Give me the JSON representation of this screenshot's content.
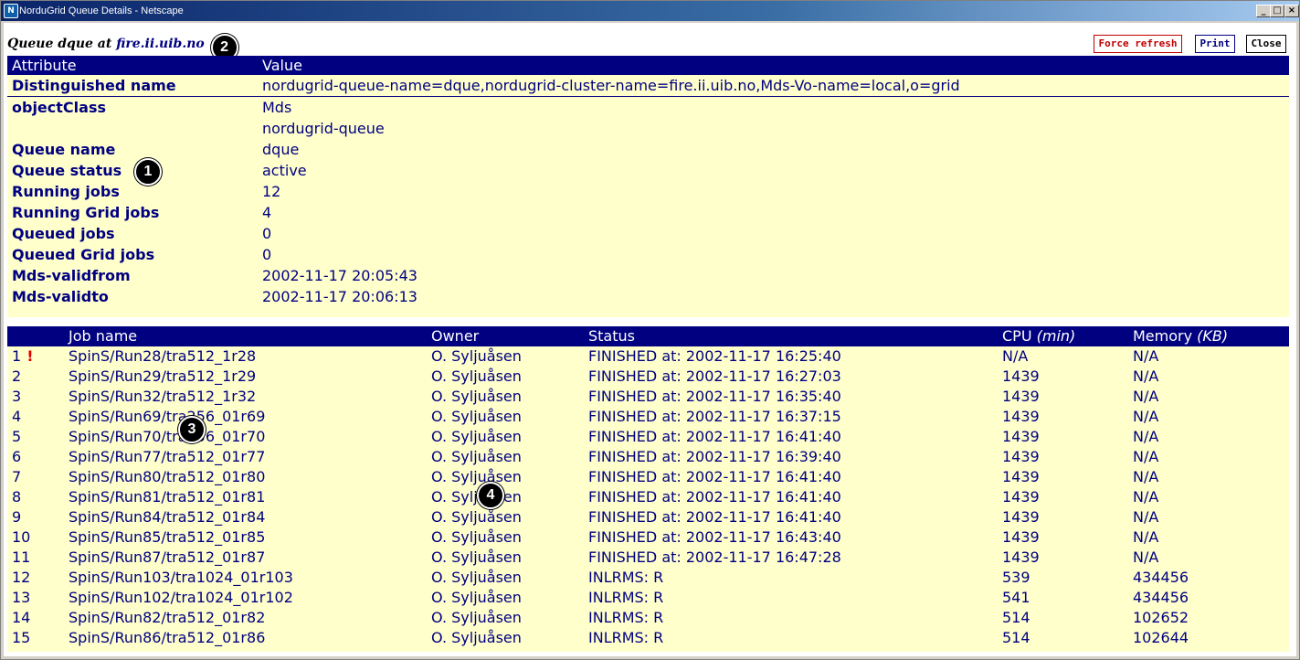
{
  "window": {
    "title": "NorduGrid Queue Details - Netscape",
    "controls": [
      "_",
      "□",
      "×"
    ]
  },
  "heading": {
    "prefix": "Queue dque at",
    "host": "fire.ii.uib.no"
  },
  "buttons": {
    "force_refresh": "Force refresh",
    "print": "Print",
    "close": "Close"
  },
  "colors": {
    "header_bg": "#000080",
    "row_bg": "#ffffcc",
    "text": "#000080",
    "alert": "#e00000"
  },
  "markers": [
    "1",
    "2",
    "3",
    "4"
  ],
  "attributes": {
    "header": {
      "attr": "Attribute",
      "value": "Value"
    },
    "rows": [
      {
        "attr": "Distinguished name",
        "value": "nordugrid-queue-name=dque,nordugrid-cluster-name=fire.ii.uib.no,Mds-Vo-name=local,o=grid"
      },
      {
        "attr": "objectClass",
        "value": "Mds"
      },
      {
        "attr": "",
        "value": "nordugrid-queue"
      },
      {
        "attr": "Queue name",
        "value": "dque"
      },
      {
        "attr": "Queue status",
        "value": "active"
      },
      {
        "attr": "Running jobs",
        "value": "12"
      },
      {
        "attr": "Running Grid jobs",
        "value": "4"
      },
      {
        "attr": "Queued jobs",
        "value": "0"
      },
      {
        "attr": "Queued Grid jobs",
        "value": "0"
      },
      {
        "attr": "Mds-validfrom",
        "value": "2002-11-17 20:05:43"
      },
      {
        "attr": "Mds-validto",
        "value": "2002-11-17 20:06:13"
      }
    ]
  },
  "jobs": {
    "header": {
      "num": "",
      "name": "Job name",
      "owner": "Owner",
      "status": "Status",
      "cpu": "CPU",
      "cpu_unit": "(min)",
      "mem": "Memory",
      "mem_unit": "(KB)"
    },
    "rows": [
      {
        "num": "1",
        "alert": "!",
        "name": "SpinS/Run28/tra512_1r28",
        "owner": "O. Syljuåsen",
        "status": "FINISHED at: 2002-11-17 16:25:40",
        "cpu": "N/A",
        "mem": "N/A"
      },
      {
        "num": "2",
        "alert": "",
        "name": "SpinS/Run29/tra512_1r29",
        "owner": "O. Syljuåsen",
        "status": "FINISHED at: 2002-11-17 16:27:03",
        "cpu": "1439",
        "mem": "N/A"
      },
      {
        "num": "3",
        "alert": "",
        "name": "SpinS/Run32/tra512_1r32",
        "owner": "O. Syljuåsen",
        "status": "FINISHED at: 2002-11-17 16:35:40",
        "cpu": "1439",
        "mem": "N/A"
      },
      {
        "num": "4",
        "alert": "",
        "name": "SpinS/Run69/tra256_01r69",
        "owner": "O. Syljuåsen",
        "status": "FINISHED at: 2002-11-17 16:37:15",
        "cpu": "1439",
        "mem": "N/A"
      },
      {
        "num": "5",
        "alert": "",
        "name": "SpinS/Run70/tra256_01r70",
        "owner": "O. Syljuåsen",
        "status": "FINISHED at: 2002-11-17 16:41:40",
        "cpu": "1439",
        "mem": "N/A"
      },
      {
        "num": "6",
        "alert": "",
        "name": "SpinS/Run77/tra512_01r77",
        "owner": "O. Syljuåsen",
        "status": "FINISHED at: 2002-11-17 16:39:40",
        "cpu": "1439",
        "mem": "N/A"
      },
      {
        "num": "7",
        "alert": "",
        "name": "SpinS/Run80/tra512_01r80",
        "owner": "O. Syljuåsen",
        "status": "FINISHED at: 2002-11-17 16:41:40",
        "cpu": "1439",
        "mem": "N/A"
      },
      {
        "num": "8",
        "alert": "",
        "name": "SpinS/Run81/tra512_01r81",
        "owner": "O. Syljuåsen",
        "status": "FINISHED at: 2002-11-17 16:41:40",
        "cpu": "1439",
        "mem": "N/A"
      },
      {
        "num": "9",
        "alert": "",
        "name": "SpinS/Run84/tra512_01r84",
        "owner": "O. Syljuåsen",
        "status": "FINISHED at: 2002-11-17 16:41:40",
        "cpu": "1439",
        "mem": "N/A"
      },
      {
        "num": "10",
        "alert": "",
        "name": "SpinS/Run85/tra512_01r85",
        "owner": "O. Syljuåsen",
        "status": "FINISHED at: 2002-11-17 16:43:40",
        "cpu": "1439",
        "mem": "N/A"
      },
      {
        "num": "11",
        "alert": "",
        "name": "SpinS/Run87/tra512_01r87",
        "owner": "O. Syljuåsen",
        "status": "FINISHED at: 2002-11-17 16:47:28",
        "cpu": "1439",
        "mem": "N/A"
      },
      {
        "num": "12",
        "alert": "",
        "name": "SpinS/Run103/tra1024_01r103",
        "owner": "O. Syljuåsen",
        "status": "INLRMS: R",
        "cpu": "539",
        "mem": "434456"
      },
      {
        "num": "13",
        "alert": "",
        "name": "SpinS/Run102/tra1024_01r102",
        "owner": "O. Syljuåsen",
        "status": "INLRMS: R",
        "cpu": "541",
        "mem": "434456"
      },
      {
        "num": "14",
        "alert": "",
        "name": "SpinS/Run82/tra512_01r82",
        "owner": "O. Syljuåsen",
        "status": "INLRMS: R",
        "cpu": "514",
        "mem": "102652"
      },
      {
        "num": "15",
        "alert": "",
        "name": "SpinS/Run86/tra512_01r86",
        "owner": "O. Syljuåsen",
        "status": "INLRMS: R",
        "cpu": "514",
        "mem": "102644"
      }
    ]
  }
}
